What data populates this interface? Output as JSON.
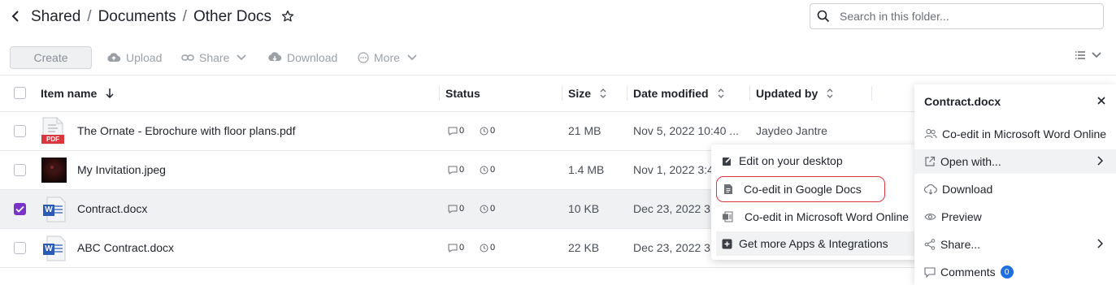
{
  "breadcrumb": {
    "items": [
      "Shared",
      "Documents",
      "Other Docs"
    ],
    "separator": "/"
  },
  "search": {
    "placeholder": "Search in this folder..."
  },
  "toolbar": {
    "create_label": "Create",
    "upload_label": "Upload",
    "share_label": "Share",
    "download_label": "Download",
    "more_label": "More"
  },
  "table": {
    "headers": {
      "name": "Item name",
      "status": "Status",
      "size": "Size",
      "date": "Date modified",
      "updated_by": "Updated by"
    },
    "rows": [
      {
        "name": "The Ornate - Ebrochure with floor plans.pdf",
        "type": "pdf",
        "type_label": "PDF",
        "comments": "0",
        "versions": "0",
        "size": "21 MB",
        "date": "Nov 5, 2022 10:40 ...",
        "updated_by": "Jaydeo Jantre",
        "checked": false
      },
      {
        "name": "My Invitation.jpeg",
        "type": "image",
        "comments": "0",
        "versions": "0",
        "size": "1.4 MB",
        "date": "Nov 1, 2022 3:4",
        "updated_by": "",
        "checked": false
      },
      {
        "name": "Contract.docx",
        "type": "word",
        "type_label": "W",
        "comments": "0",
        "versions": "0",
        "size": "10 KB",
        "date": "Dec 23, 2022 3",
        "updated_by": "",
        "checked": true
      },
      {
        "name": "ABC Contract.docx",
        "type": "word",
        "type_label": "W",
        "comments": "0",
        "versions": "0",
        "size": "22 KB",
        "date": "Dec 23, 2022 3",
        "updated_by": "",
        "checked": false
      }
    ]
  },
  "open_with_menu": {
    "items": [
      {
        "label": "Edit on your desktop",
        "icon": "edit-desktop-icon"
      },
      {
        "label": "Co-edit in Google Docs",
        "icon": "google-docs-icon"
      },
      {
        "label": "Co-edit in Microsoft Word Online",
        "icon": "word-online-icon"
      },
      {
        "label": "Get more Apps & Integrations",
        "icon": "add-apps-icon"
      }
    ]
  },
  "side_panel": {
    "title": "Contract.docx",
    "items": [
      {
        "label": "Co-edit in Microsoft Word Online",
        "icon": "co-edit-users-icon"
      },
      {
        "label": "Open with...",
        "icon": "open-external-icon"
      },
      {
        "label": "Download",
        "icon": "cloud-download-icon"
      },
      {
        "label": "Preview",
        "icon": "eye-icon"
      },
      {
        "label": "Share...",
        "icon": "share-nodes-icon"
      },
      {
        "label": "Comments",
        "icon": "comment-icon",
        "badge": "0"
      }
    ]
  },
  "colors": {
    "accent": "#7b33c7",
    "badge": "#1f6fe0",
    "highlight_ring": "#d9363e",
    "pdf": "#d9363e",
    "word": "#2b5bb5"
  }
}
